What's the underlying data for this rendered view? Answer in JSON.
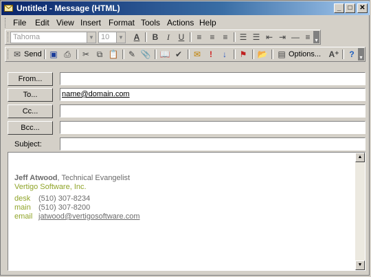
{
  "window": {
    "title": "Untitled - Message (HTML)",
    "controls": {
      "minimize": "_",
      "maximize": "□",
      "close": "✕"
    }
  },
  "menu": [
    "File",
    "Edit",
    "View",
    "Insert",
    "Format",
    "Tools",
    "Actions",
    "Help"
  ],
  "format_toolbar": {
    "font": "Tahoma",
    "size": "10"
  },
  "standard_toolbar": {
    "send": "Send",
    "options": "Options..."
  },
  "header": {
    "from_button": "From...",
    "to_button": "To...",
    "cc_button": "Cc...",
    "bcc_button": "Bcc...",
    "subject_label": "Subject:",
    "from_value": "",
    "to_value": "name@domain.com",
    "cc_value": "",
    "bcc_value": "",
    "subject_value": ""
  },
  "signature": {
    "name": "Jeff Atwood",
    "title": ", Technical Evangelist",
    "company": "Vertigo Software, Inc.",
    "rows": [
      {
        "label": "desk",
        "value": "(510) 307-8234"
      },
      {
        "label": "main",
        "value": "(510) 307-8200"
      },
      {
        "label": "email",
        "value": "jatwood@vertigosoftware.com"
      }
    ]
  },
  "colors": {
    "accent_green": "#8fa428",
    "title_bar": "#0a246a"
  }
}
